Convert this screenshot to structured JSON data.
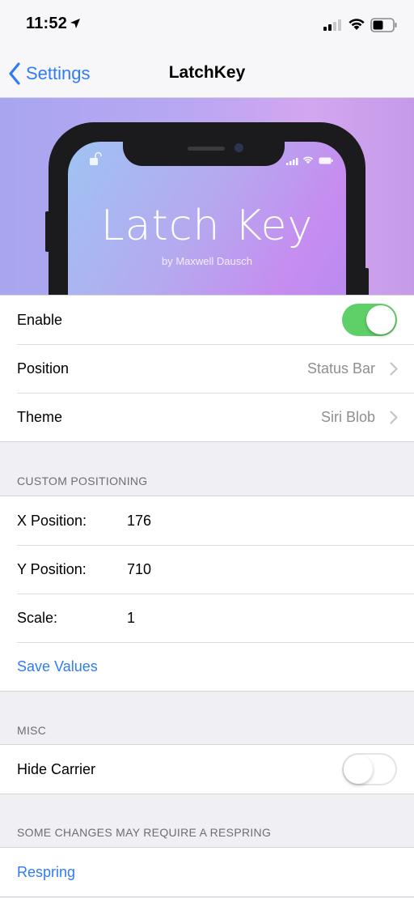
{
  "status_bar": {
    "time": "11:52",
    "icons": [
      "location-arrow-icon",
      "cellular-signal-icon",
      "wifi-icon",
      "battery-icon"
    ]
  },
  "nav": {
    "back_label": "Settings",
    "title": "LatchKey"
  },
  "banner": {
    "title": "Latch Key",
    "subtitle": "by Maxwell Dausch",
    "icons": [
      "unlock-icon",
      "cellular-signal-icon",
      "wifi-icon",
      "battery-icon"
    ]
  },
  "main": {
    "enable_label": "Enable",
    "enable_on": true,
    "position_label": "Position",
    "position_value": "Status Bar",
    "theme_label": "Theme",
    "theme_value": "Siri Blob"
  },
  "custom_positioning": {
    "header": "CUSTOM POSITIONING",
    "x_label": "X Position:",
    "x_value": "176",
    "y_label": "Y Position:",
    "y_value": "710",
    "scale_label": "Scale:",
    "scale_value": "1",
    "save_label": "Save Values"
  },
  "misc": {
    "header": "MISC",
    "hide_carrier_label": "Hide Carrier",
    "hide_carrier_on": false
  },
  "respring": {
    "header": "SOME CHANGES MAY REQUIRE A RESPRING",
    "button_label": "Respring"
  },
  "colors": {
    "accent": "#2f7cf6",
    "toggle_on": "#5fd068",
    "background": "#efeff4"
  }
}
